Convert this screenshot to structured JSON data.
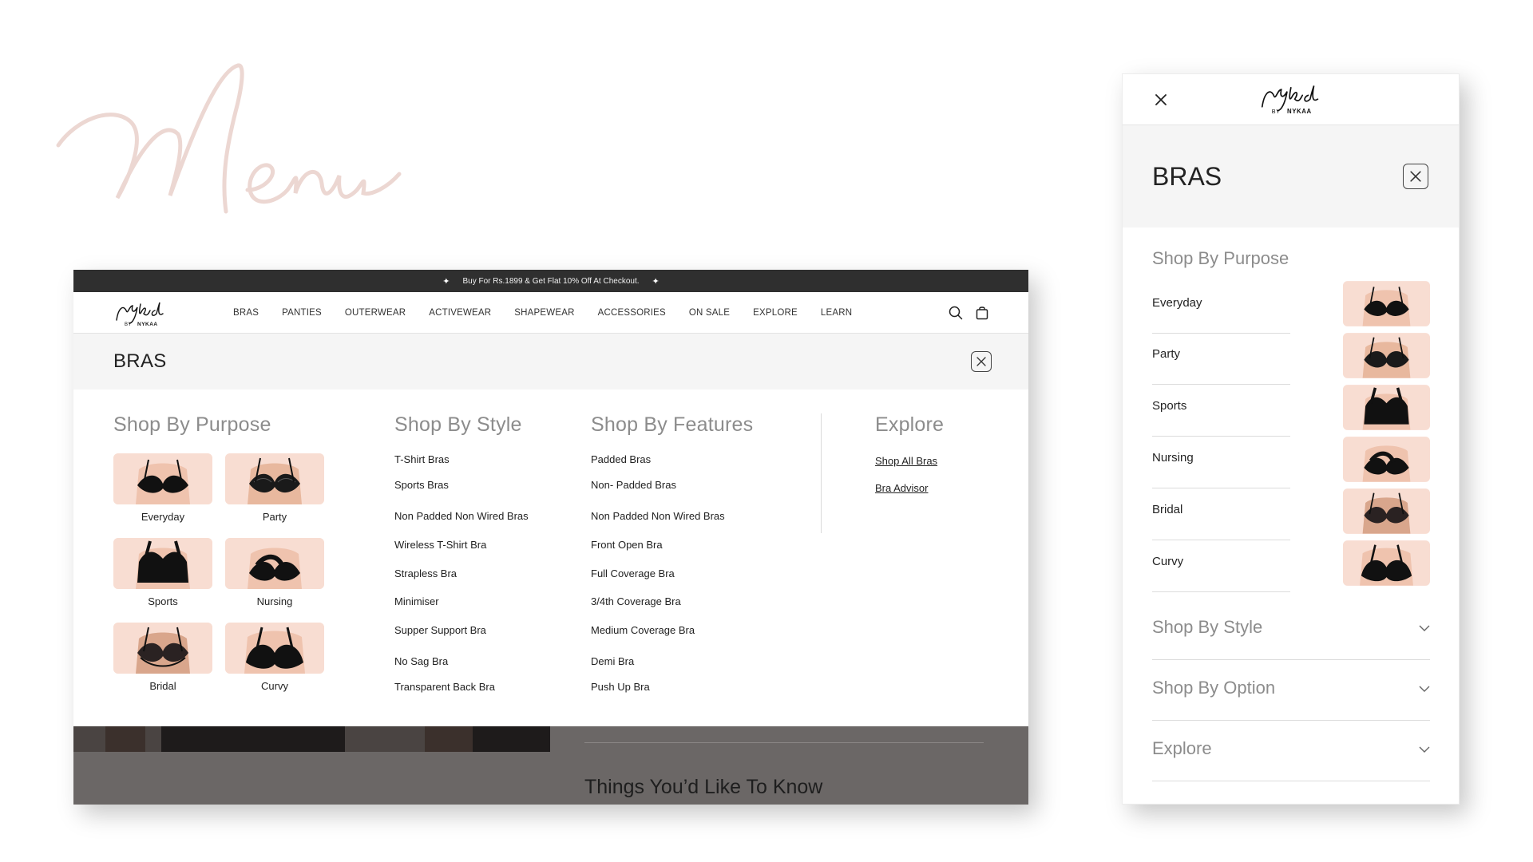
{
  "desktop": {
    "promo_text": "Buy For Rs.1899 & Get Flat 10% Off At Checkout.",
    "nav": [
      "BRAS",
      "PANTIES",
      "OUTERWEAR",
      "ACTIVEWEAR",
      "SHAPEWEAR",
      "ACCESSORIES",
      "ON SALE",
      "EXPLORE",
      "LEARN"
    ],
    "category_title": "BRAS",
    "purpose": {
      "heading": "Shop By Purpose",
      "items": [
        "Everyday",
        "Party",
        "Sports",
        "Nursing",
        "Bridal",
        "Curvy"
      ]
    },
    "style": {
      "heading": "Shop By Style",
      "items": [
        "T-Shirt Bras",
        "Sports Bras",
        "Non Padded Non Wired Bras",
        "Wireless T-Shirt Bra",
        "Strapless Bra",
        "Minimiser",
        "Supper Support Bra",
        "No Sag Bra",
        "Transparent Back Bra"
      ]
    },
    "features": {
      "heading": "Shop By Features",
      "items": [
        "Padded Bras",
        "Non- Padded Bras",
        "Non Padded Non Wired Bras",
        "Front Open  Bra",
        "Full Coverage  Bra",
        "3/4th Coverage Bra",
        "Medium Coverage Bra",
        "Demi Bra",
        "Push Up Bra"
      ]
    },
    "explore": {
      "heading": "Explore",
      "items": [
        "Shop All Bras",
        "Bra Advisor"
      ]
    },
    "background_heading": "Things You’d Like To Know"
  },
  "mobile": {
    "category_title": "BRAS",
    "purpose_heading": "Shop By Purpose",
    "purpose_items": [
      "Everyday",
      "Party",
      "Sports",
      "Nursing",
      "Bridal",
      "Curvy"
    ],
    "accordions": [
      "Shop By Style",
      "Shop By Option",
      "Explore"
    ]
  },
  "colors": {
    "promo_bg": "#2f2f2f",
    "band_bg": "#f5f5f5",
    "muted_heading": "#8c8c8c",
    "thumb_bg": "#fbe9e2",
    "script_title": "#ecd7d2"
  }
}
